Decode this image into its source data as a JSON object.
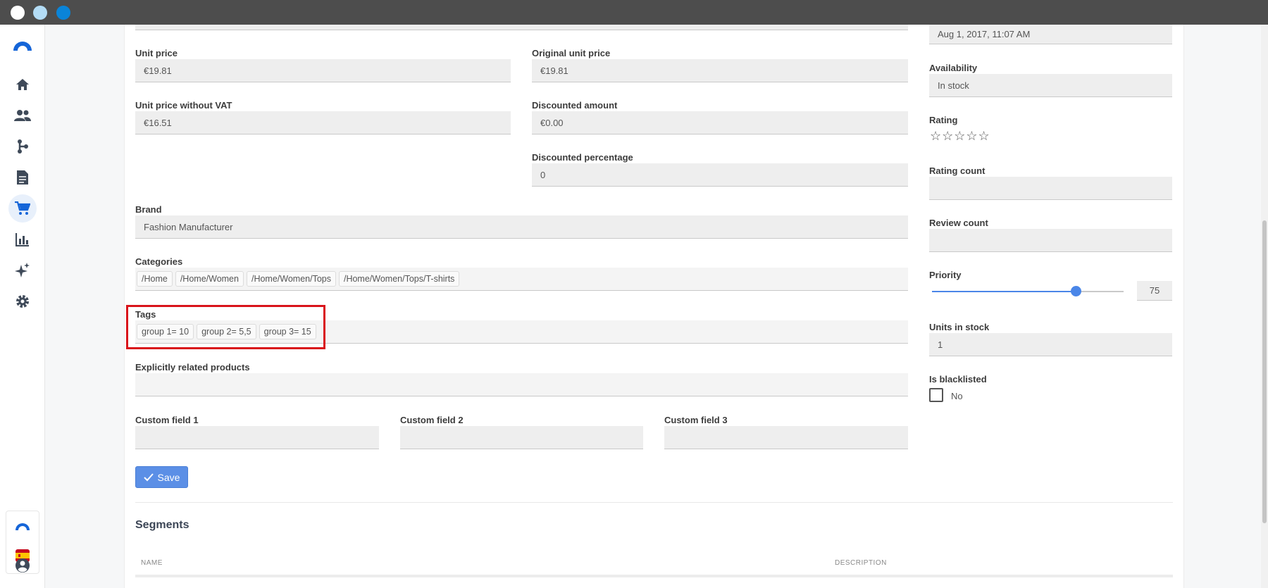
{
  "window": {
    "dots": [
      "#ffffff",
      "#b3dcf5",
      "#0a84d8"
    ]
  },
  "sidebar": {
    "icons": [
      "logo-icon",
      "home-icon",
      "people-icon",
      "flow-icon",
      "document-icon",
      "cart-icon",
      "bar-chart-icon",
      "sparkle-icon",
      "gear-icon"
    ],
    "active": "cart-icon",
    "bottom_icons": [
      "brand-icon",
      "spain-flag-icon",
      "user-circle-icon"
    ]
  },
  "form": {
    "unit_price": {
      "label": "Unit price",
      "value": "€19.81"
    },
    "original_unit_price": {
      "label": "Original unit price",
      "value": "€19.81"
    },
    "unit_price_without_vat": {
      "label": "Unit price without VAT",
      "value": "€16.51"
    },
    "discounted_amount": {
      "label": "Discounted amount",
      "value": "€0.00"
    },
    "discounted_percentage": {
      "label": "Discounted percentage",
      "value": "0"
    },
    "brand": {
      "label": "Brand",
      "value": "Fashion Manufacturer"
    },
    "categories": {
      "label": "Categories",
      "items": [
        "/Home",
        "/Home/Women",
        "/Home/Women/Tops",
        "/Home/Women/Tops/T-shirts"
      ]
    },
    "tags": {
      "label": "Tags",
      "items": [
        "group 1= 10",
        "group 2= 5,5",
        "group 3= 15"
      ]
    },
    "related": {
      "label": "Explicitly related products",
      "value": ""
    },
    "custom1": {
      "label": "Custom field 1",
      "value": ""
    },
    "custom2": {
      "label": "Custom field 2",
      "value": ""
    },
    "custom3": {
      "label": "Custom field 3",
      "value": ""
    },
    "save_label": "Save"
  },
  "side": {
    "date_value": "Aug 1, 2017, 11:07 AM",
    "availability": {
      "label": "Availability",
      "value": "In stock"
    },
    "rating": {
      "label": "Rating",
      "stars": "☆☆☆☆☆",
      "value_stars": 0,
      "max_stars": 5
    },
    "rating_count": {
      "label": "Rating count",
      "value": ""
    },
    "review_count": {
      "label": "Review count",
      "value": ""
    },
    "priority": {
      "label": "Priority",
      "value": "75",
      "fraction": 0.75
    },
    "units_in_stock": {
      "label": "Units in stock",
      "value": "1"
    },
    "blacklisted": {
      "label": "Is blacklisted",
      "value": "No"
    }
  },
  "segments": {
    "title": "Segments",
    "columns": [
      "NAME",
      "DESCRIPTION"
    ]
  },
  "colors": {
    "accent": "#4a86e8",
    "highlight": "#d9141b"
  }
}
